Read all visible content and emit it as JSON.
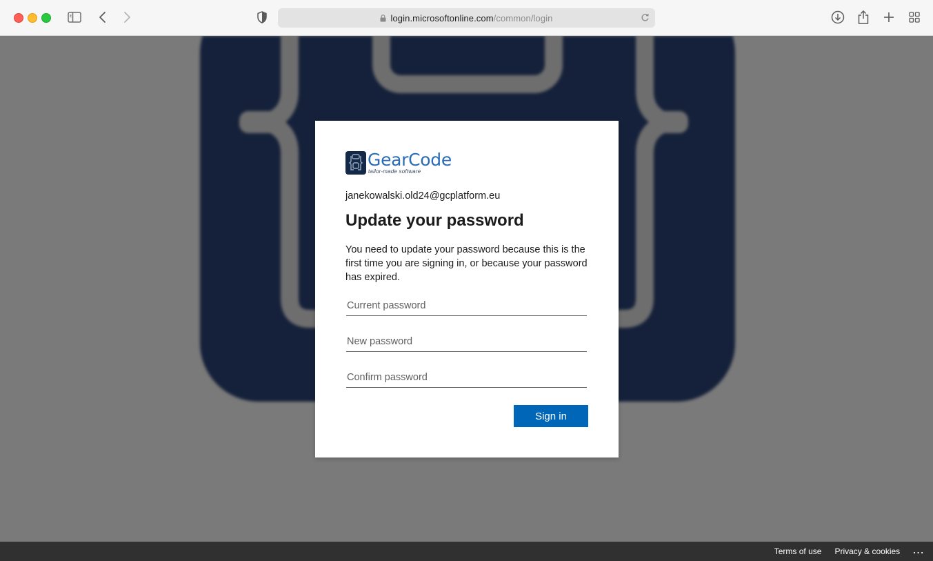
{
  "browser": {
    "url_host": "login.microsoftonline.com",
    "url_path": "/common/login"
  },
  "brand": {
    "name": "GearCode",
    "tagline": "tailor-made software"
  },
  "login": {
    "user_email": "janekowalski.old24@gcplatform.eu",
    "title": "Update your password",
    "description": "You need to update your password because this is the first time you are signing in, or because your password has expired.",
    "current_password_placeholder": "Current password",
    "new_password_placeholder": "New password",
    "confirm_password_placeholder": "Confirm password",
    "signin_label": "Sign in"
  },
  "footer": {
    "terms_label": "Terms of use",
    "privacy_label": "Privacy & cookies",
    "more_label": "..."
  },
  "colors": {
    "accent": "#0067b8",
    "brand_navy": "#14294a",
    "brand_blue": "#2b6cb6",
    "footer_bg": "#303030"
  }
}
